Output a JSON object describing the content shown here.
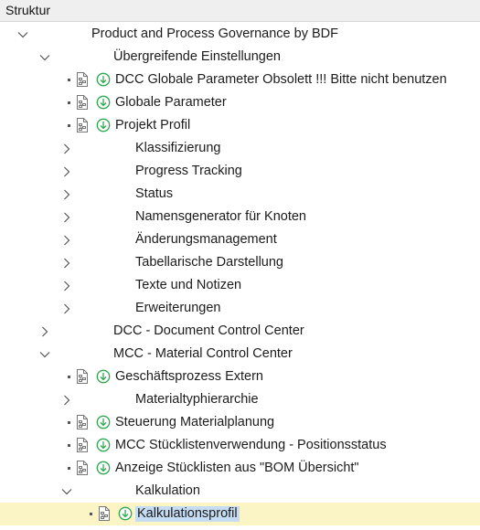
{
  "header": {
    "title": "Struktur"
  },
  "tree": {
    "rows": [
      {
        "label": "Product and Process Governance by BDF",
        "level": 0,
        "toggle": "expanded",
        "icons": false
      },
      {
        "label": "Übergreifende Einstellungen",
        "level": 1,
        "toggle": "expanded",
        "icons": false
      },
      {
        "label": "DCC Globale Parameter  Obsolett !!! Bitte nicht benutzen",
        "level": 2,
        "toggle": "leaf",
        "icons": true
      },
      {
        "label": "Globale Parameter",
        "level": 2,
        "toggle": "leaf",
        "icons": true
      },
      {
        "label": "Projekt Profil",
        "level": 2,
        "toggle": "leaf",
        "icons": true
      },
      {
        "label": "Klassifizierung",
        "level": 2,
        "toggle": "collapsed",
        "icons": false
      },
      {
        "label": "Progress Tracking",
        "level": 2,
        "toggle": "collapsed",
        "icons": false
      },
      {
        "label": "Status",
        "level": 2,
        "toggle": "collapsed",
        "icons": false
      },
      {
        "label": "Namensgenerator für Knoten",
        "level": 2,
        "toggle": "collapsed",
        "icons": false
      },
      {
        "label": "Änderungsmanagement",
        "level": 2,
        "toggle": "collapsed",
        "icons": false
      },
      {
        "label": "Tabellarische Darstellung",
        "level": 2,
        "toggle": "collapsed",
        "icons": false
      },
      {
        "label": "Texte und Notizen",
        "level": 2,
        "toggle": "collapsed",
        "icons": false
      },
      {
        "label": "Erweiterungen",
        "level": 2,
        "toggle": "collapsed",
        "icons": false
      },
      {
        "label": "DCC - Document Control Center",
        "level": 1,
        "toggle": "collapsed",
        "icons": false
      },
      {
        "label": "MCC - Material Control Center",
        "level": 1,
        "toggle": "expanded",
        "icons": false
      },
      {
        "label": "Geschäftsprozess Extern",
        "level": 2,
        "toggle": "leaf",
        "icons": true
      },
      {
        "label": "Materialtyphierarchie",
        "level": 2,
        "toggle": "collapsed",
        "icons": false
      },
      {
        "label": "Steuerung Materialplanung",
        "level": 2,
        "toggle": "leaf",
        "icons": true
      },
      {
        "label": "MCC Stücklistenverwendung - Positionsstatus",
        "level": 2,
        "toggle": "leaf",
        "icons": true
      },
      {
        "label": "Anzeige Stücklisten aus \"BOM Übersicht\"",
        "level": 2,
        "toggle": "leaf",
        "icons": true
      },
      {
        "label": "Kalkulation",
        "level": 2,
        "toggle": "expanded",
        "icons": false
      },
      {
        "label": "Kalkulationsprofil",
        "level": 3,
        "toggle": "leaf",
        "icons": true,
        "selected": true
      }
    ]
  },
  "colors": {
    "selected_row": "#fbf4c4",
    "selected_label": "#c5dcf2",
    "execute_icon": "#2fa84f"
  },
  "icons": {
    "expanded": "chevron-down-icon",
    "collapsed": "chevron-right-icon",
    "node": "document-icon",
    "execute": "execute-icon"
  }
}
